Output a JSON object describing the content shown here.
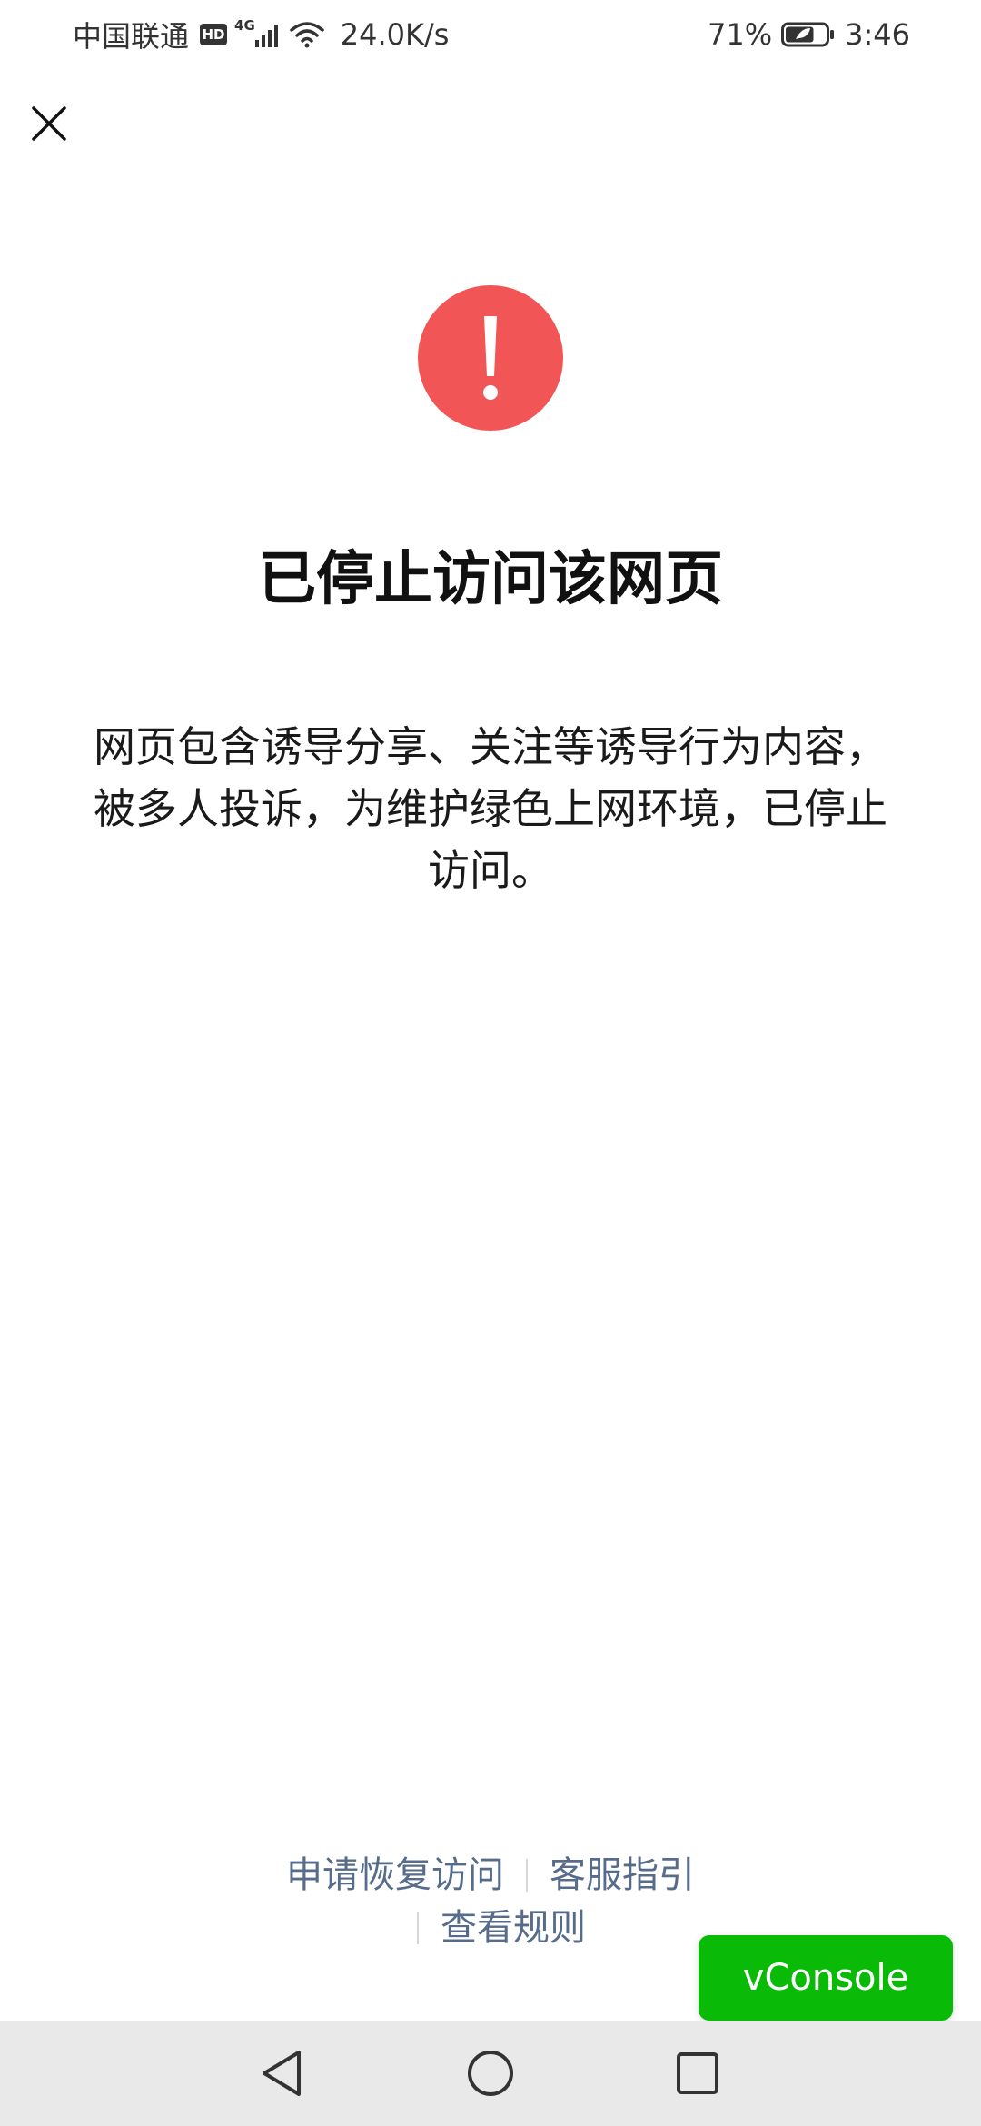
{
  "status_bar": {
    "carrier": "中国联通",
    "hd_badge": "HD",
    "network_type": "4G",
    "net_speed": "24.0K/s",
    "battery_percent": "71%",
    "battery_level": 0.71,
    "time": "3:46",
    "icons": [
      "signal-icon",
      "wifi-icon",
      "battery-icon"
    ]
  },
  "close_button": {
    "icon": "close-icon"
  },
  "warning": {
    "icon": "exclamation-circle-icon",
    "color": "#f25555"
  },
  "page": {
    "title": "已停止访问该网页",
    "description": "网页包含诱导分享、关注等诱导行为内容，被多人投诉，为维护绿色上网环境，已停止访问。"
  },
  "links": {
    "appeal": "申请恢复访问",
    "support": "客服指引",
    "rules": "查看规则",
    "color": "#576b8a"
  },
  "vconsole": {
    "label": "vConsole",
    "color": "#09bb07"
  },
  "nav_bar": {
    "icons": [
      "back-triangle-icon",
      "home-circle-icon",
      "recent-square-icon"
    ]
  }
}
